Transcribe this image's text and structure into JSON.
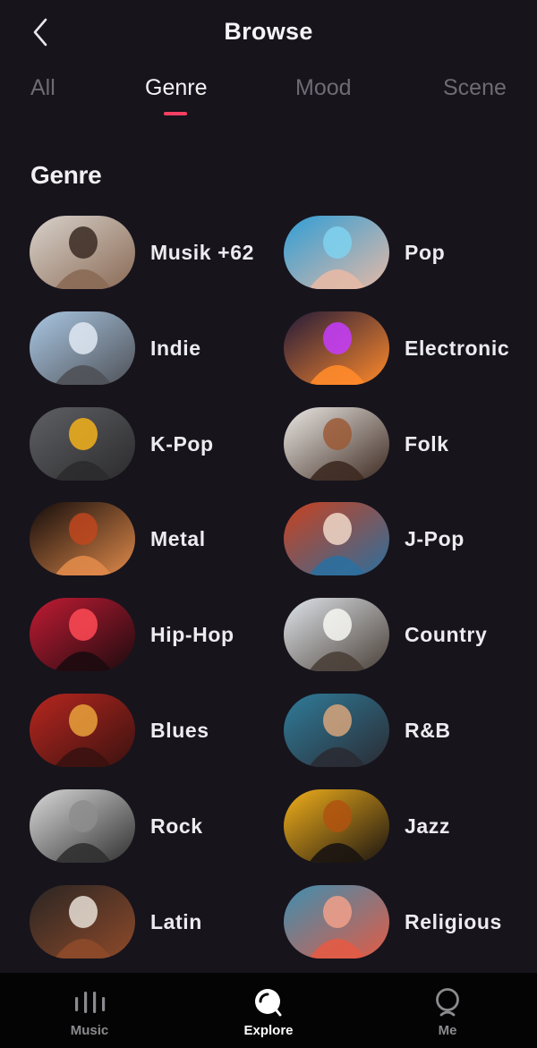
{
  "header": {
    "title": "Browse"
  },
  "tabs": [
    {
      "label": "All"
    },
    {
      "label": "Genre"
    },
    {
      "label": "Mood"
    },
    {
      "label": "Scene"
    }
  ],
  "active_tab": "Genre",
  "section": {
    "title": "Genre"
  },
  "genres": [
    {
      "label": "Musik +62",
      "colors": [
        "#d8d2cb",
        "#3a2a22",
        "#8a6a55"
      ]
    },
    {
      "label": "Pop",
      "colors": [
        "#2f9ed6",
        "#7fd2f0",
        "#e5b9a6"
      ]
    },
    {
      "label": "Indie",
      "colors": [
        "#a9c7e3",
        "#dfe9f3",
        "#4f5157"
      ]
    },
    {
      "label": "Electronic",
      "colors": [
        "#231a3a",
        "#c53cff",
        "#ff8a2a"
      ]
    },
    {
      "label": "K-Pop",
      "colors": [
        "#5f6064",
        "#f3b21b",
        "#2b2b2d"
      ]
    },
    {
      "label": "Folk",
      "colors": [
        "#ebe8e4",
        "#9b5a36",
        "#3d2a21"
      ]
    },
    {
      "label": "Metal",
      "colors": [
        "#120b0b",
        "#c0461f",
        "#e08a4a"
      ]
    },
    {
      "label": "J-Pop",
      "colors": [
        "#c9411f",
        "#f0d8c8",
        "#2c6f9e"
      ]
    },
    {
      "label": "Hip-Hop",
      "colors": [
        "#c21b33",
        "#ff4a55",
        "#1c0b0f"
      ]
    },
    {
      "label": "Country",
      "colors": [
        "#dfe4ea",
        "#f7f7f2",
        "#4a4038"
      ]
    },
    {
      "label": "Blues",
      "colors": [
        "#b8261f",
        "#e9a23b",
        "#3a1210"
      ]
    },
    {
      "label": "R&B",
      "colors": [
        "#2f7c9a",
        "#d7a57b",
        "#2a2b33"
      ]
    },
    {
      "label": "Rock",
      "colors": [
        "#d9d9d9",
        "#8d8d8d",
        "#303030"
      ]
    },
    {
      "label": "Jazz",
      "colors": [
        "#f2b01b",
        "#b0520f",
        "#1a1411"
      ]
    },
    {
      "label": "Latin",
      "colors": [
        "#2a2523",
        "#e7dfd6",
        "#8e4a2a"
      ]
    },
    {
      "label": "Religious",
      "colors": [
        "#3d8fb0",
        "#f1a08a",
        "#e25b45"
      ]
    }
  ],
  "bottom_nav": [
    {
      "label": "Music",
      "icon": "bars-icon"
    },
    {
      "label": "Explore",
      "icon": "explore-icon"
    },
    {
      "label": "Me",
      "icon": "profile-icon"
    }
  ],
  "active_nav": "Explore",
  "colors": {
    "background": "#17141c",
    "accent": "#ff3f62",
    "nav_background": "#040404"
  }
}
